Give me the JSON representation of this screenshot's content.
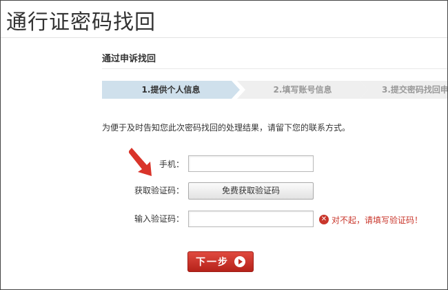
{
  "page": {
    "title": "通行证密码找回"
  },
  "section": {
    "title": "通过申诉找回"
  },
  "steps": [
    {
      "label": "1.提供个人信息",
      "active": true
    },
    {
      "label": "2.填写账号信息",
      "active": false
    },
    {
      "label": "3.提交密码找回申",
      "active": false
    }
  ],
  "notice": "为便于及时告知您此次密码找回的处理结果，请留下您的联系方式。",
  "form": {
    "phone_label": "手机：",
    "phone_value": "",
    "get_code_label": "获取验证码：",
    "get_code_button": "免费获取验证码",
    "enter_code_label": "输入验证码：",
    "code_value": "",
    "error_text": "对不起，请填写验证码！",
    "next_button": "下一步"
  },
  "colors": {
    "accent_red": "#c9362b",
    "step_active": "#cfe0ec",
    "step_inactive": "#efefef"
  },
  "icons": {
    "error": "error-x-icon",
    "next": "play-arrow-icon",
    "annotation": "red-arrow-icon"
  }
}
